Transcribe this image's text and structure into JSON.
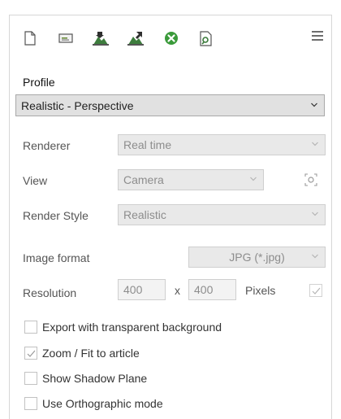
{
  "toolbar": {
    "icons": [
      "new-document-icon",
      "render-region-icon",
      "export-image-icon",
      "export-image-alt-icon",
      "cancel-icon",
      "document-search-icon"
    ],
    "menu_icon": "hamburger-menu-icon"
  },
  "profile": {
    "label": "Profile",
    "value": "Realistic - Perspective"
  },
  "renderer": {
    "label": "Renderer",
    "value": "Real time"
  },
  "view": {
    "label": "View",
    "value": "Camera",
    "camera_icon": "camera-target-icon"
  },
  "render_style": {
    "label": "Render Style",
    "value": "Realistic"
  },
  "image_format": {
    "label": "Image format",
    "value": "JPG (*.jpg)"
  },
  "resolution": {
    "label": "Resolution",
    "width": "400",
    "separator": "x",
    "height": "400",
    "unit": "Pixels",
    "locked": true
  },
  "options": [
    {
      "label": "Export with transparent background",
      "checked": false
    },
    {
      "label": "Zoom / Fit to article",
      "checked": true
    },
    {
      "label": "Show Shadow Plane",
      "checked": false
    },
    {
      "label": "Use Orthographic mode",
      "checked": false
    }
  ],
  "colors": {
    "green": "#3a9a3a",
    "icon_gray": "#6d6d6d",
    "accent_dark": "#2a5d2a"
  }
}
